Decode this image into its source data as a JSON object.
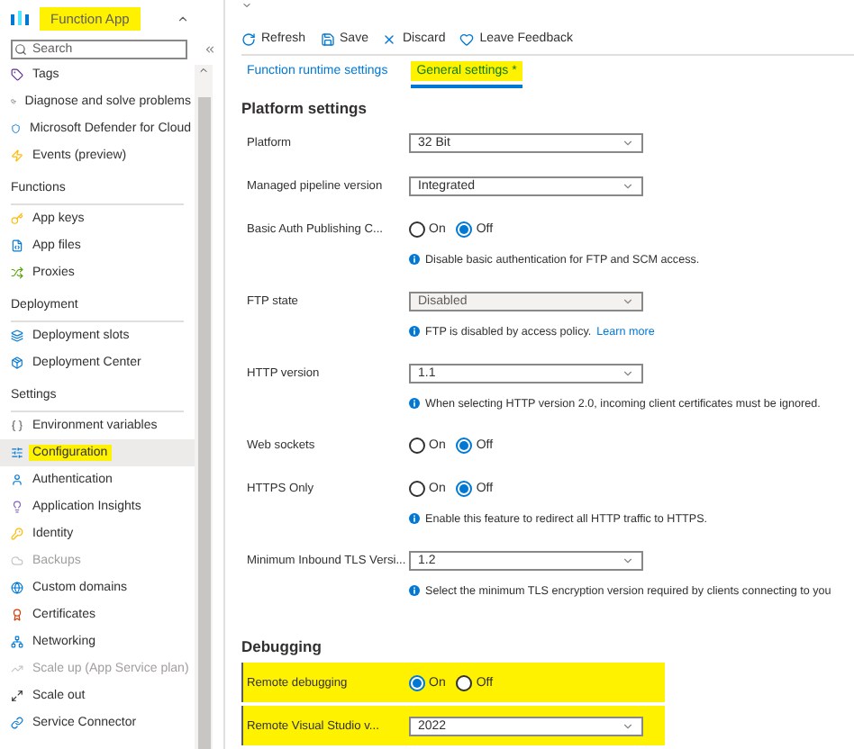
{
  "sidebar": {
    "title": "Function App",
    "title_highlighted": true,
    "search": {
      "placeholder": "Search"
    },
    "groups": [
      {
        "items": [
          {
            "label": "Tags",
            "selected": false,
            "disabled": false,
            "highlighted": false
          },
          {
            "label": "Diagnose and solve problems",
            "selected": false,
            "disabled": false,
            "highlighted": false
          },
          {
            "label": "Microsoft Defender for Cloud",
            "selected": false,
            "disabled": false,
            "highlighted": false
          },
          {
            "label": "Events (preview)",
            "selected": false,
            "disabled": false,
            "highlighted": false
          }
        ]
      },
      {
        "heading": "Functions",
        "items": [
          {
            "label": "App keys",
            "selected": false,
            "disabled": false,
            "highlighted": false
          },
          {
            "label": "App files",
            "selected": false,
            "disabled": false,
            "highlighted": false
          },
          {
            "label": "Proxies",
            "selected": false,
            "disabled": false,
            "highlighted": false
          }
        ]
      },
      {
        "heading": "Deployment",
        "items": [
          {
            "label": "Deployment slots",
            "selected": false,
            "disabled": false,
            "highlighted": false
          },
          {
            "label": "Deployment Center",
            "selected": false,
            "disabled": false,
            "highlighted": false
          }
        ]
      },
      {
        "heading": "Settings",
        "items": [
          {
            "label": "Environment variables",
            "selected": false,
            "disabled": false,
            "highlighted": false
          },
          {
            "label": "Configuration",
            "selected": true,
            "disabled": false,
            "highlighted": true
          },
          {
            "label": "Authentication",
            "selected": false,
            "disabled": false,
            "highlighted": false
          },
          {
            "label": "Application Insights",
            "selected": false,
            "disabled": false,
            "highlighted": false
          },
          {
            "label": "Identity",
            "selected": false,
            "disabled": false,
            "highlighted": false
          },
          {
            "label": "Backups",
            "selected": false,
            "disabled": true,
            "highlighted": false
          },
          {
            "label": "Custom domains",
            "selected": false,
            "disabled": false,
            "highlighted": false
          },
          {
            "label": "Certificates",
            "selected": false,
            "disabled": false,
            "highlighted": false
          },
          {
            "label": "Networking",
            "selected": false,
            "disabled": false,
            "highlighted": false
          },
          {
            "label": "Scale up (App Service plan)",
            "selected": false,
            "disabled": true,
            "highlighted": false
          },
          {
            "label": "Scale out",
            "selected": false,
            "disabled": false,
            "highlighted": false
          },
          {
            "label": "Service Connector",
            "selected": false,
            "disabled": false,
            "highlighted": false
          }
        ]
      }
    ]
  },
  "toolbar": [
    "Refresh",
    "Save",
    "Discard",
    "Leave Feedback"
  ],
  "tabs": [
    {
      "label": "Function runtime settings",
      "selected": false,
      "highlighted": false
    },
    {
      "label": "General settings *",
      "selected": true,
      "highlighted": true
    }
  ],
  "sections": [
    {
      "heading": "Platform settings",
      "settings": [
        {
          "kind": "select",
          "label": "Platform",
          "value": "32 Bit",
          "disabled": false,
          "highlighted": false
        },
        {
          "kind": "select",
          "label": "Managed pipeline version",
          "value": "Integrated",
          "disabled": false,
          "highlighted": false
        },
        {
          "kind": "radio",
          "label": "Basic Auth Publishing C...",
          "highlighted": false,
          "options": [
            {
              "label": "On",
              "selected": false
            },
            {
              "label": "Off",
              "selected": true
            }
          ],
          "note": {
            "text": "Disable basic authentication for FTP and SCM access."
          }
        },
        {
          "kind": "select",
          "label": "FTP state",
          "value": "Disabled",
          "disabled": true,
          "highlighted": false,
          "note": {
            "text": "FTP is disabled by access policy.",
            "link": "Learn more"
          }
        },
        {
          "kind": "select",
          "label": "HTTP version",
          "value": "1.1",
          "disabled": false,
          "highlighted": false,
          "note": {
            "text": "When selecting HTTP version 2.0, incoming client certificates must be ignored."
          }
        },
        {
          "kind": "radio",
          "label": "Web sockets",
          "highlighted": false,
          "options": [
            {
              "label": "On",
              "selected": false
            },
            {
              "label": "Off",
              "selected": true
            }
          ]
        },
        {
          "kind": "radio",
          "label": "HTTPS Only",
          "highlighted": false,
          "options": [
            {
              "label": "On",
              "selected": false
            },
            {
              "label": "Off",
              "selected": true
            }
          ],
          "note": {
            "text": "Enable this feature to redirect all HTTP traffic to HTTPS."
          }
        },
        {
          "kind": "select",
          "label": "Minimum Inbound TLS Versi...",
          "value": "1.2",
          "disabled": false,
          "highlighted": false,
          "note": {
            "text": "Select the minimum TLS encryption version required by clients connecting to you"
          }
        }
      ]
    },
    {
      "heading": "Debugging",
      "settings": [
        {
          "kind": "radio",
          "label": "Remote debugging",
          "highlighted": true,
          "options": [
            {
              "label": "On",
              "selected": true
            },
            {
              "label": "Off",
              "selected": false
            }
          ]
        },
        {
          "kind": "select",
          "label": "Remote Visual Studio v...",
          "value": "2022",
          "disabled": false,
          "highlighted": true
        }
      ]
    }
  ]
}
